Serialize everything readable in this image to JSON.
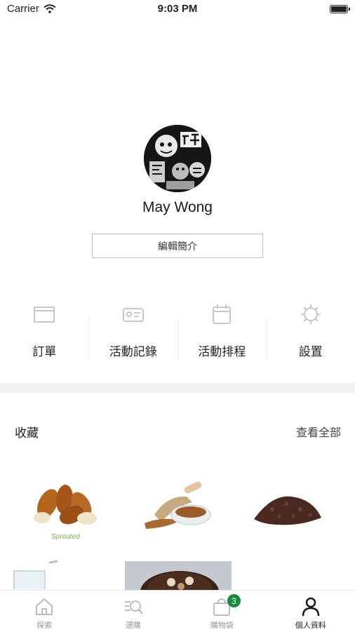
{
  "status_bar": {
    "carrier": "Carrier",
    "time": "9:03 PM"
  },
  "profile": {
    "name": "May Wong",
    "edit_label": "編輯簡介"
  },
  "quick_actions": [
    {
      "label": "訂單",
      "icon": "box-icon"
    },
    {
      "label": "活動記錄",
      "icon": "id-card-icon"
    },
    {
      "label": "活動排程",
      "icon": "calendar-icon"
    },
    {
      "label": "設置",
      "icon": "gear-icon"
    }
  ],
  "favorites": {
    "title": "收藏",
    "view_all": "查看全部",
    "items": [
      {
        "name": "almonds",
        "brand_text": "Sprouted"
      },
      {
        "name": "flax-seeds"
      },
      {
        "name": "cacao-nibs"
      },
      {
        "name": "water-glass"
      },
      {
        "name": "chocolate-cake"
      }
    ]
  },
  "tab_bar": {
    "tabs": [
      {
        "label": "探索",
        "icon": "home-icon",
        "active": false
      },
      {
        "label": "選購",
        "icon": "search-list-icon",
        "active": false
      },
      {
        "label": "購物袋",
        "icon": "bag-icon",
        "active": false
      },
      {
        "label": "個人資料",
        "icon": "person-icon",
        "active": true
      }
    ],
    "bag_count": "3"
  },
  "colors": {
    "badge": "#1a8a3f",
    "divider": "#f2f2f2",
    "icon_inactive": "#c8c8c8"
  }
}
